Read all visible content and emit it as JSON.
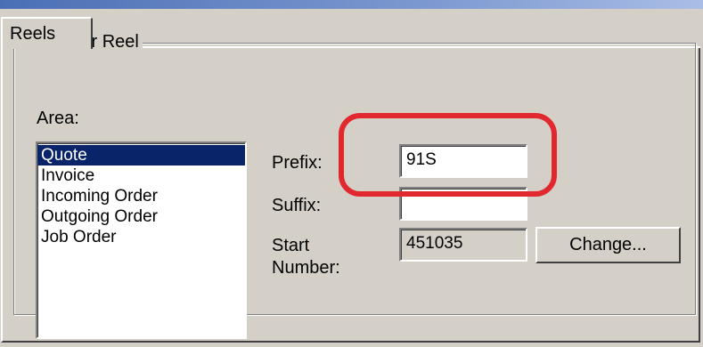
{
  "window": {
    "tab_label": "Reels"
  },
  "group": {
    "title": "Number Reel"
  },
  "area": {
    "label": "Area:",
    "items": [
      "Quote",
      "Invoice",
      "Incoming Order",
      "Outgoing Order",
      "Job Order"
    ],
    "selected": "Quote"
  },
  "fields": {
    "prefix_label": "Prefix:",
    "prefix_value": "91S",
    "suffix_label": "Suffix:",
    "suffix_value": "",
    "start_label_line1": "Start",
    "start_label_line2": "Number:",
    "start_value": "451035"
  },
  "buttons": {
    "change_label": "Change..."
  },
  "colors": {
    "highlight_ring": "#e0282e",
    "selection": "#0a246a",
    "face": "#d4d0c8"
  }
}
